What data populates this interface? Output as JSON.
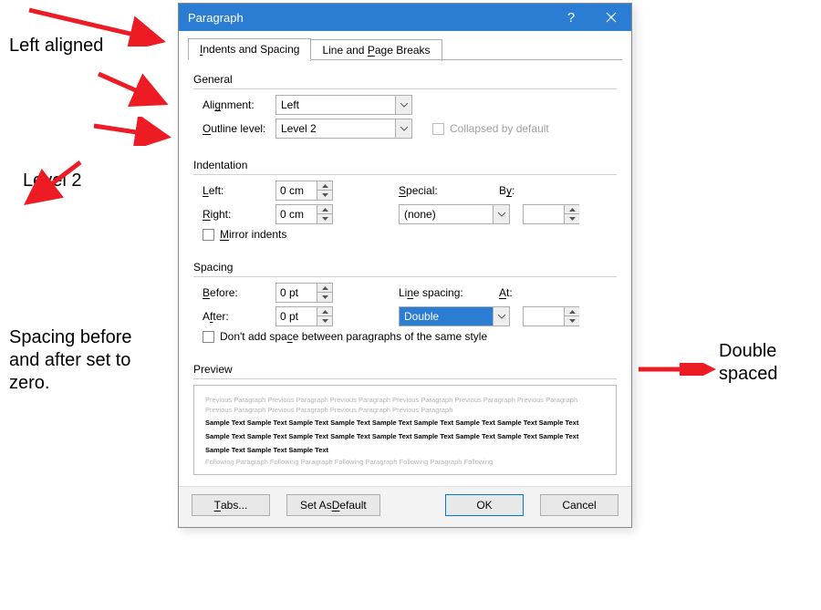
{
  "title": "Paragraph",
  "tabs": {
    "t1": "Indents and Spacing",
    "t2": "Line and Page Breaks"
  },
  "general": {
    "heading": "General",
    "alignment_lbl": "Alignment:",
    "alignment_val": "Left",
    "outline_lbl": "Outline level:",
    "outline_val": "Level 2",
    "collapsed_lbl": "Collapsed by default"
  },
  "indent": {
    "heading": "Indentation",
    "left_lbl": "Left:",
    "left_val": "0 cm",
    "right_lbl": "Right:",
    "right_val": "0 cm",
    "special_lbl": "Special:",
    "special_val": "(none)",
    "by_lbl": "By:",
    "by_val": "",
    "mirror_lbl": "Mirror indents"
  },
  "spacing": {
    "heading": "Spacing",
    "before_lbl": "Before:",
    "before_val": "0 pt",
    "after_lbl": "After:",
    "after_val": "0 pt",
    "ls_lbl": "Line spacing:",
    "ls_val": "Double",
    "at_lbl": "At:",
    "at_val": "",
    "dontadd_lbl": "Don't add space between paragraphs of the same style"
  },
  "preview": {
    "heading": "Preview",
    "prev": "Previous Paragraph Previous Paragraph Previous Paragraph Previous Paragraph Previous Paragraph Previous Paragraph Previous Paragraph Previous Paragraph Previous Paragraph Previous Paragraph",
    "sample": "Sample Text Sample Text Sample Text Sample Text Sample Text Sample Text Sample Text Sample Text Sample Text Sample Text Sample Text Sample Text Sample Text Sample Text Sample Text Sample Text Sample Text Sample Text Sample Text Sample Text Sample Text",
    "foll": "Following Paragraph Following Paragraph Following Paragraph Following Paragraph Following"
  },
  "buttons": {
    "tabs": "Tabs...",
    "def": "Set As Default",
    "ok": "OK",
    "cancel": "Cancel"
  },
  "annotations": {
    "a1": "Left aligned",
    "a2": "Level 2",
    "a3": "Spacing before and after set to zero.",
    "a4": "Double spaced"
  }
}
